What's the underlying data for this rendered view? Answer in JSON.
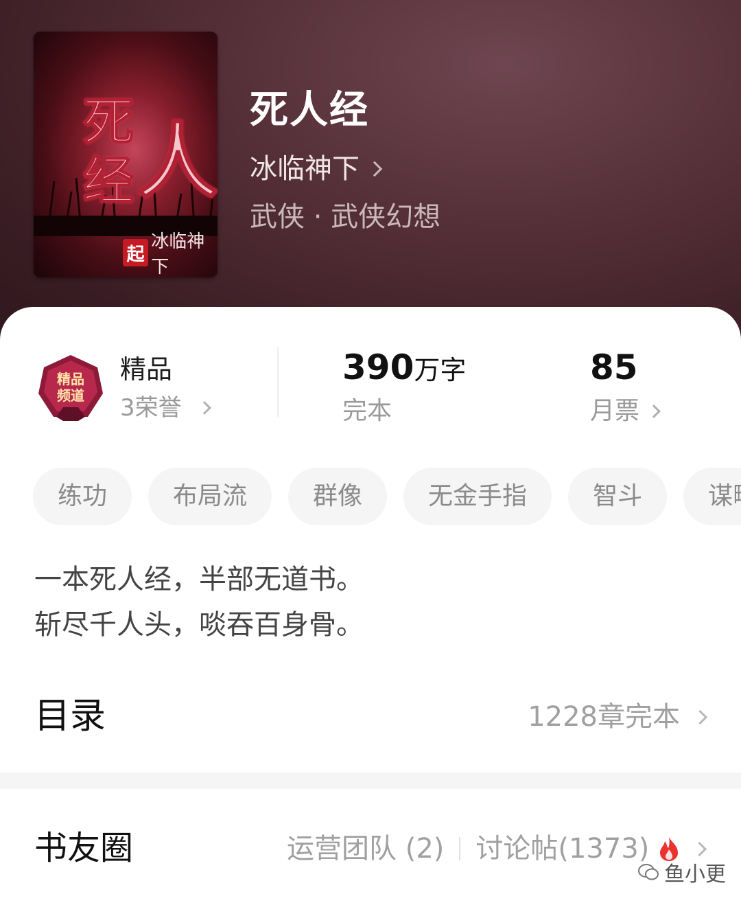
{
  "book": {
    "title": "死人经",
    "author": "冰临神下",
    "genre": "武侠 · 武侠幻想",
    "cover": {
      "title_chars": [
        "死",
        "经",
        "人"
      ],
      "logo_char": "起",
      "author_text": "冰临神下"
    }
  },
  "stats": {
    "honor": {
      "label": "精品",
      "sub": "3荣誉"
    },
    "words": {
      "value": "390",
      "unit": "万字",
      "sub": "完本"
    },
    "tickets": {
      "value": "85",
      "sub": "月票"
    }
  },
  "tags": [
    "练功",
    "布局流",
    "群像",
    "无金手指",
    "智斗",
    "谋略"
  ],
  "description": {
    "line1": "一本死人经，半部无道书。",
    "line2": "斩尽千人头，啖吞百身骨。"
  },
  "toc": {
    "title": "目录",
    "status": "1228章完本"
  },
  "club": {
    "title": "书友圈",
    "team": "运营团队 (2)",
    "posts": "讨论帖(1373)"
  },
  "watermark": "鱼小更",
  "colors": {
    "accent_red": "#e8332f",
    "hero_bg": "#4a262d"
  }
}
